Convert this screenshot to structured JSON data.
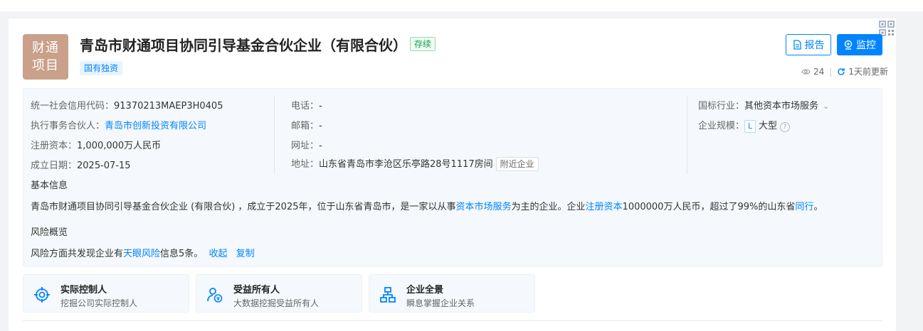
{
  "company": {
    "logo_line1": "财通",
    "logo_line2": "项目",
    "name": "青岛市财通项目协同引导基金合伙企业（有限合伙）",
    "status": "存续",
    "tag": "国有独资"
  },
  "actions": {
    "report_label": "报告",
    "monitor_label": "监控",
    "views": "24",
    "updated": "1天前更新"
  },
  "info": {
    "credit_code_label": "统一社会信用代码：",
    "credit_code": "91370213MAEP3H0405",
    "partner_label": "执行事务合伙人：",
    "partner": "青岛市创新投资有限公司",
    "capital_label": "注册资本：",
    "capital": "1,000,000万人民币",
    "date_label": "成立日期：",
    "date": "2025-07-15",
    "phone_label": "电话：",
    "phone": "-",
    "email_label": "邮箱：",
    "email": "-",
    "website_label": "网址：",
    "website": "-",
    "address_label": "地址：",
    "address": "山东省青岛市李沧区乐亭路28号1117房间",
    "nearby_label": "附近企业",
    "industry_label": "国标行业：",
    "industry": "其他资本市场服务",
    "scale_label": "企业规模：",
    "scale_badge": "L",
    "scale": "大型"
  },
  "basic": {
    "heading": "基本信息",
    "desc_part1": "青岛市财通项目协同引导基金合伙企业 (有限合伙) ，成立于2025年，位于山东省青岛市，是一家以从事",
    "desc_link1": "资本市场服务",
    "desc_part2": "为主的企业。企业",
    "desc_link2": "注册资本",
    "desc_part3": "1000000万人民币，超过了99%的山东省",
    "desc_link3": "同行",
    "desc_part4": "。"
  },
  "risk": {
    "heading": "风险概览",
    "text_part1": "风险方面共发现企业有",
    "text_link": "天眼风险",
    "text_part2": "信息5条。",
    "collapse": "收起",
    "copy": "复制"
  },
  "features": [
    {
      "title": "实际控制人",
      "sub": "挖掘公司实际控制人"
    },
    {
      "title": "受益所有人",
      "sub": "大数据挖掘受益所有人"
    },
    {
      "title": "企业全景",
      "sub": "瞬息掌握企业关系"
    }
  ],
  "colors": {
    "accent": "#0084ff",
    "logo_bg": "#c9a089",
    "status_green": "#17a34a"
  }
}
